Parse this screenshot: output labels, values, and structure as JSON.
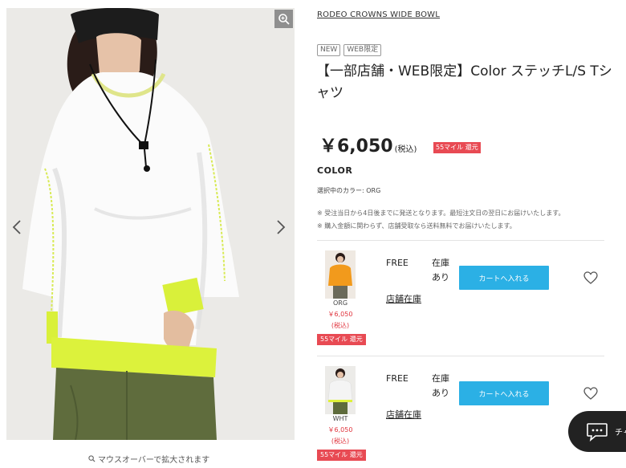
{
  "gallery": {
    "hover_note": "マウスオーバーで拡大されます"
  },
  "product": {
    "brand": "RODEO CROWNS WIDE BOWL",
    "badges": [
      "NEW",
      "WEB限定"
    ],
    "title": "【一部店舗・WEB限定】Color ステッチL/S Tシャツ",
    "price": "￥6,050",
    "tax": "(税込)",
    "mile_badge": "55マイル 還元",
    "color_heading": "COLOR",
    "selected_color": "選択中のカラー: ORG",
    "notes": [
      "※ 受注当日から4日後までに発送となります。最短注文日の翌日にお届けいたします。",
      "※ 購入金額に関わらず、店舗受取なら送料無料でお届けいたします。"
    ]
  },
  "variants": [
    {
      "color_code": "ORG",
      "price": "￥6,050",
      "tax": "(税込)",
      "mile": "55マイル 還元",
      "size": "FREE",
      "stock_line1": "在庫",
      "stock_line2": "あり",
      "cart_label": "カートへ入れる",
      "store_stock": "店舗在庫",
      "thumb_color": "#f29a1c"
    },
    {
      "color_code": "WHT",
      "price": "￥6,050",
      "tax": "(税込)",
      "mile": "55マイル 還元",
      "size": "FREE",
      "stock_line1": "在庫",
      "stock_line2": "あり",
      "cart_label": "カートへ入れる",
      "store_stock": "店舗在庫",
      "thumb_color": "#f4f4f4"
    }
  ],
  "chat": {
    "label": "チャ",
    "icon": "chat-bubble-icon"
  },
  "colors": {
    "accent_blue": "#2bb0e5",
    "mile_red": "#e84a53",
    "neon_yellow": "#dff23a",
    "skirt_olive": "#5e6b3c"
  }
}
